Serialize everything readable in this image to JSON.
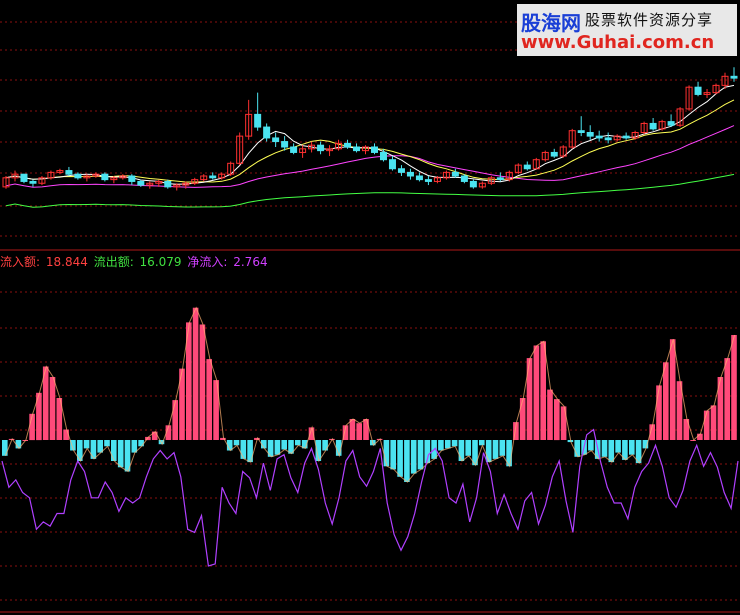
{
  "legend": {
    "inflow_label": "流入额: ",
    "inflow_value": "18.844",
    "outflow_label": "流出额: ",
    "outflow_value": "16.079",
    "net_label": "净流入: ",
    "net_value": "2.764"
  },
  "watermark": {
    "site_name": "股海网",
    "tagline": "股票软件资源分享",
    "url": "www.Guhai.com.cn"
  },
  "colors": {
    "background": "#000000",
    "up": "#ff4a7a",
    "down": "#4be3f0",
    "ma5": "#ffffff",
    "ma10": "#ffff55",
    "ma20": "#ff44ff",
    "ma60": "#44ff44",
    "inflow_text": "#ff4040",
    "outflow_text": "#40e040",
    "net_text": "#d040ff",
    "net_line": "#b040ff",
    "grid": "#8a1010"
  },
  "chart_data": [
    {
      "type": "candlestick",
      "series": [
        {
          "candles": [
            [
              100,
              106,
              99,
              105
            ],
            [
              105,
              109,
              103,
              107
            ],
            [
              107,
              107,
              102,
              103
            ],
            [
              103,
              104,
              100,
              102
            ],
            [
              102,
              106,
              101,
              105
            ],
            [
              105,
              109,
              104,
              108
            ],
            [
              108,
              110,
              107,
              109
            ],
            [
              109,
              111,
              106,
              107
            ],
            [
              107,
              108,
              104,
              105
            ],
            [
              105,
              107,
              103,
              106
            ],
            [
              106,
              108,
              105,
              107
            ],
            [
              107,
              108,
              103,
              104
            ],
            [
              104,
              106,
              102,
              105
            ],
            [
              105,
              107,
              104,
              106
            ],
            [
              106,
              107,
              101,
              103
            ],
            [
              103,
              104,
              100,
              101
            ],
            [
              101,
              103,
              99,
              102
            ],
            [
              102,
              104,
              100,
              103
            ],
            [
              103,
              104,
              99,
              100
            ],
            [
              100,
              102,
              98,
              101
            ],
            [
              101,
              103,
              99,
              102
            ],
            [
              102,
              105,
              101,
              104
            ],
            [
              104,
              107,
              103,
              106
            ],
            [
              106,
              108,
              104,
              105
            ],
            [
              105,
              108,
              104,
              107
            ],
            [
              107,
              114,
              106,
              113
            ],
            [
              113,
              130,
              112,
              128
            ],
            [
              128,
              148,
              126,
              140
            ],
            [
              140,
              152,
              131,
              133
            ],
            [
              133,
              135,
              125,
              127
            ],
            [
              127,
              130,
              122,
              125
            ],
            [
              125,
              128,
              120,
              122
            ],
            [
              122,
              124,
              118,
              119
            ],
            [
              119,
              123,
              116,
              121
            ],
            [
              121,
              125,
              119,
              123
            ],
            [
              123,
              125,
              118,
              120
            ],
            [
              120,
              123,
              117,
              121
            ],
            [
              121,
              126,
              120,
              124
            ],
            [
              124,
              126,
              121,
              122
            ],
            [
              122,
              124,
              119,
              120
            ],
            [
              120,
              123,
              118,
              122
            ],
            [
              122,
              124,
              118,
              119
            ],
            [
              119,
              121,
              114,
              115
            ],
            [
              115,
              117,
              109,
              110
            ],
            [
              110,
              112,
              106,
              108
            ],
            [
              108,
              110,
              104,
              106
            ],
            [
              106,
              108,
              103,
              104
            ],
            [
              104,
              106,
              101,
              103
            ],
            [
              103,
              106,
              102,
              105
            ],
            [
              105,
              109,
              104,
              108
            ],
            [
              108,
              110,
              105,
              106
            ],
            [
              106,
              107,
              102,
              103
            ],
            [
              103,
              104,
              99,
              100
            ],
            [
              100,
              103,
              99,
              102
            ],
            [
              102,
              106,
              101,
              105
            ],
            [
              105,
              108,
              103,
              104
            ],
            [
              104,
              109,
              103,
              108
            ],
            [
              108,
              113,
              107,
              112
            ],
            [
              112,
              114,
              109,
              110
            ],
            [
              110,
              116,
              110,
              115
            ],
            [
              115,
              120,
              114,
              119
            ],
            [
              119,
              121,
              116,
              117
            ],
            [
              117,
              123,
              116,
              122
            ],
            [
              122,
              132,
              121,
              131
            ],
            [
              131,
              139,
              128,
              130
            ],
            [
              130,
              134,
              126,
              128
            ],
            [
              128,
              131,
              125,
              127
            ],
            [
              127,
              130,
              124,
              126
            ],
            [
              126,
              129,
              125,
              128
            ],
            [
              128,
              130,
              126,
              127
            ],
            [
              127,
              131,
              126,
              130
            ],
            [
              130,
              136,
              129,
              135
            ],
            [
              135,
              138,
              131,
              132
            ],
            [
              132,
              137,
              131,
              136
            ],
            [
              136,
              140,
              133,
              134
            ],
            [
              134,
              144,
              133,
              143
            ],
            [
              143,
              156,
              142,
              155
            ],
            [
              155,
              158,
              150,
              151
            ],
            [
              151,
              154,
              149,
              152
            ],
            [
              152,
              157,
              151,
              156
            ],
            [
              156,
              163,
              154,
              161
            ],
            [
              161,
              166,
              158,
              160
            ]
          ]
        }
      ]
    },
    {
      "type": "bar",
      "series": [
        {
          "name": "流入额",
          "values": [
            -15,
            1,
            -8,
            0,
            25,
            45,
            70,
            60,
            40,
            10,
            -10,
            -20,
            -8,
            -18,
            -12,
            -6,
            -20,
            -26,
            -30,
            -12,
            -6,
            3,
            8,
            -4,
            14,
            38,
            68,
            112,
            126,
            110,
            77,
            57,
            2,
            -10,
            -5,
            -18,
            -21,
            2,
            -8,
            -16,
            -14,
            -9,
            -13,
            -5,
            -8,
            12,
            -20,
            -10,
            1,
            -15,
            14,
            20,
            16,
            20,
            -5,
            1,
            -25,
            -28,
            -35,
            -40,
            -32,
            -28,
            -22,
            -18,
            -10,
            -8,
            -6,
            -20,
            -15,
            -24,
            -5,
            -21,
            -18,
            -15,
            -25,
            17,
            40,
            78,
            90,
            94,
            48,
            39,
            32,
            -2,
            -16,
            -14,
            -10,
            -18,
            -16,
            -21,
            -12,
            -19,
            -14,
            -22,
            -8,
            15,
            52,
            74,
            96,
            56,
            20,
            0,
            6,
            28,
            33,
            60,
            78,
            100
          ]
        }
      ]
    },
    {
      "type": "line",
      "series": [
        {
          "name": "净流入",
          "values": [
            -20,
            -45,
            -38,
            -50,
            -55,
            -85,
            -78,
            -82,
            -70,
            -70,
            -38,
            -20,
            -30,
            -55,
            -55,
            -40,
            -50,
            -68,
            -55,
            -60,
            -55,
            -35,
            -18,
            -10,
            -18,
            -12,
            -35,
            -85,
            -88,
            -72,
            -120,
            -118,
            -45,
            -60,
            -70,
            -30,
            -36,
            -55,
            -22,
            -48,
            -18,
            -14,
            -36,
            -50,
            -22,
            -8,
            -28,
            -60,
            -80,
            -55,
            -20,
            -10,
            -35,
            -44,
            -30,
            -8,
            -60,
            -90,
            -105,
            -92,
            -70,
            -40,
            -14,
            -8,
            -20,
            -55,
            -60,
            -42,
            -78,
            -55,
            -12,
            -30,
            -70,
            -52,
            -70,
            -85,
            -58,
            -50,
            -80,
            -62,
            -35,
            -20,
            -58,
            -88,
            -25,
            5,
            10,
            -20,
            -45,
            -60,
            -60,
            -75,
            -45,
            -30,
            -22,
            -5,
            -25,
            -55,
            -64,
            -48,
            -20,
            -5,
            -25,
            -12,
            -26,
            -50,
            -65,
            -20
          ]
        }
      ]
    }
  ]
}
